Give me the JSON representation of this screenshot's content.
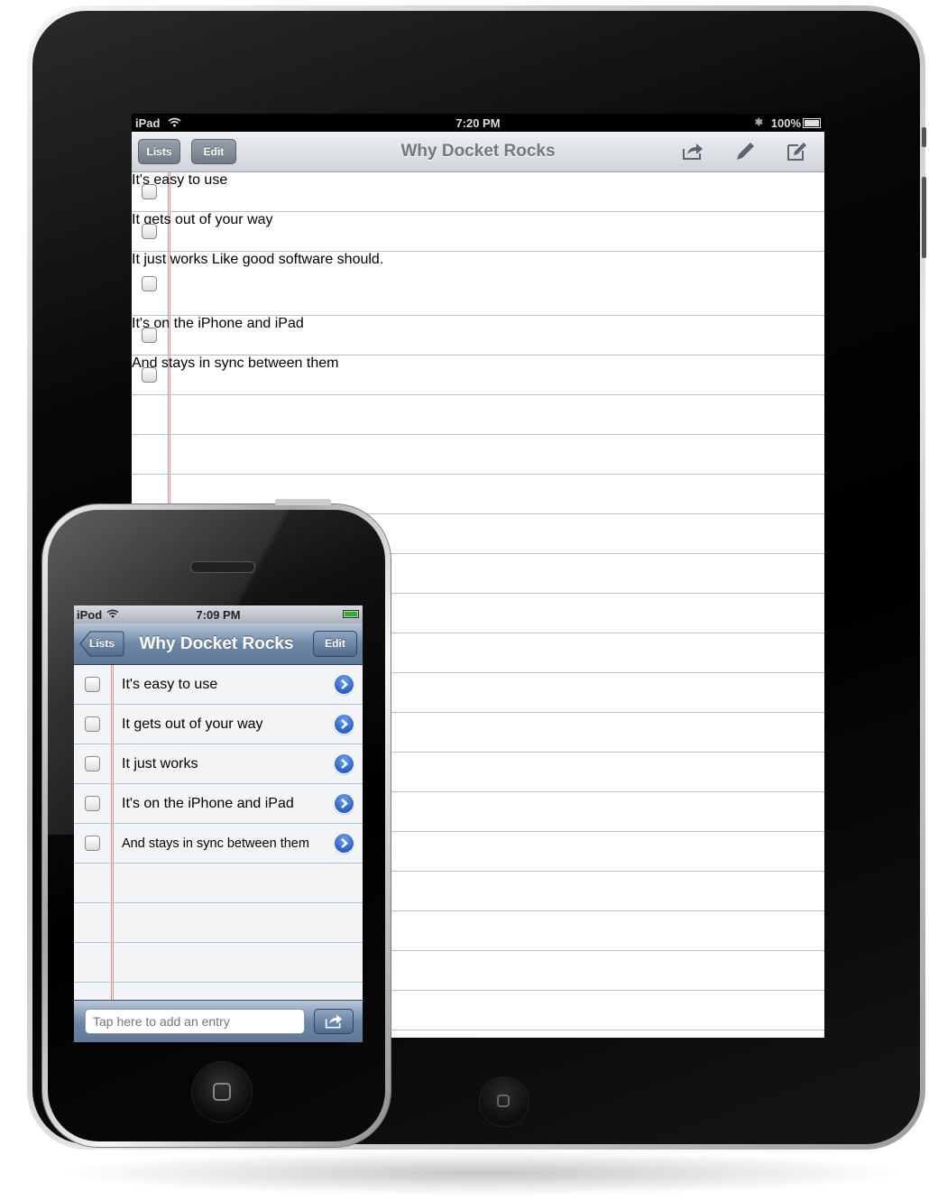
{
  "ipad": {
    "status": {
      "carrier": "iPad",
      "time": "7:20 PM",
      "battery": "100%"
    },
    "nav": {
      "lists_label": "Lists",
      "edit_label": "Edit",
      "title": "Why Docket Rocks"
    },
    "items": [
      {
        "text": "It's easy to use",
        "note": ""
      },
      {
        "text": "It gets out of your way",
        "note": ""
      },
      {
        "text": "It just works",
        "note": "Like good software should."
      },
      {
        "text": "It's on the iPhone and iPad",
        "note": ""
      },
      {
        "text": "And stays in sync between them",
        "note": ""
      }
    ]
  },
  "iphone": {
    "status": {
      "carrier": "iPod",
      "time": "7:09 PM"
    },
    "nav": {
      "back_label": "Lists",
      "title": "Why Docket Rocks",
      "edit_label": "Edit"
    },
    "items": [
      {
        "text": "It's easy to use"
      },
      {
        "text": "It gets out of your way"
      },
      {
        "text": "It just works"
      },
      {
        "text": "It's on the iPhone and iPad"
      },
      {
        "text": "And stays in sync between them"
      }
    ],
    "entry_placeholder": "Tap here to add an entry"
  },
  "colors": {
    "accent_blue": "#2a62c6",
    "nav_blue": "#6f87a6",
    "margin_red": "#d98f8f",
    "rule_blue": "#a9c6d8"
  },
  "icons": [
    "wifi-icon",
    "bluetooth-icon",
    "battery-icon",
    "share-icon",
    "pencil-icon",
    "compose-icon",
    "disclosure-icon",
    "checkbox-icon"
  ]
}
